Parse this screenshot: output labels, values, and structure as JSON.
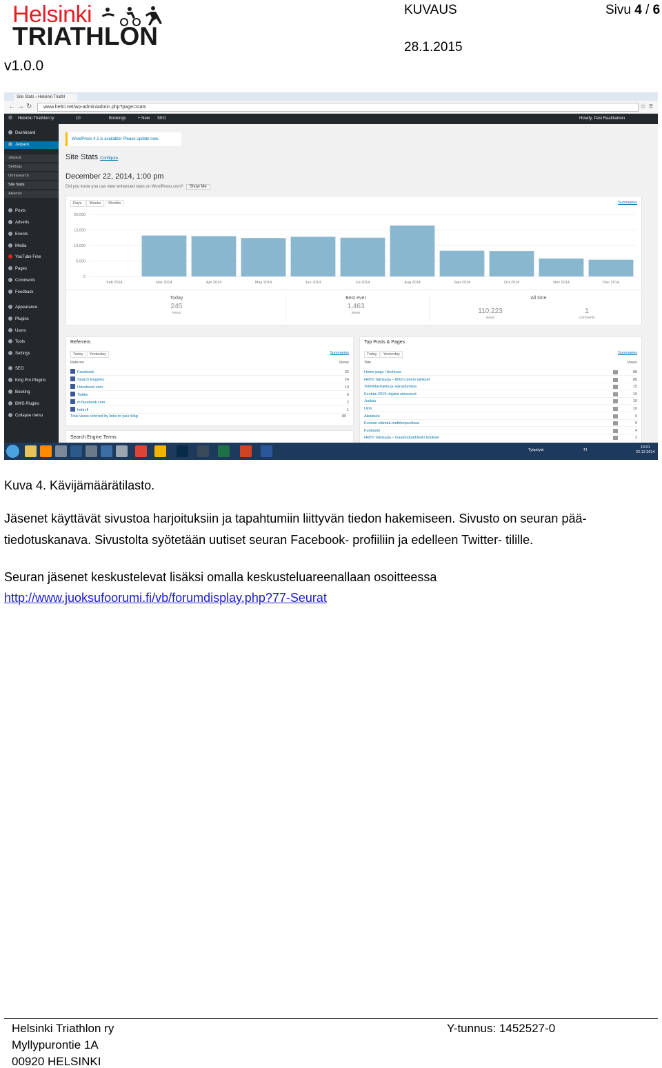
{
  "header": {
    "logo_top": "Helsinki",
    "logo_bottom": "TRIATHLON",
    "version": "v1.0.0",
    "doc_title": "KUVAUS",
    "doc_date": "28.1.2015",
    "page_prefix": "Sivu",
    "page_current": "4",
    "page_sep": "/",
    "page_total": "6"
  },
  "screenshot": {
    "browser_tab": "Site Stats ‹ Helsinki Triathl",
    "url": "www.heltri.net/wp-admin/admin.php?page=stats",
    "adminbar": {
      "site": "Helsinki Triathlon ry",
      "updates": "10",
      "bookings": "Bookings",
      "new": "+ New",
      "seo": "SEO",
      "howdy": "Howdy, Pasi Raatikainen"
    },
    "sidebar": [
      {
        "label": "Dashboard"
      },
      {
        "label": "Jetpack"
      },
      {
        "label": "Jetpack"
      },
      {
        "label": "Settings"
      },
      {
        "label": "Omnisearch"
      },
      {
        "label": "Site Stats"
      },
      {
        "label": "Akismet"
      },
      {
        "label": "Posts"
      },
      {
        "label": "Adverts"
      },
      {
        "label": "Events"
      },
      {
        "label": "Media"
      },
      {
        "label": "YouTube Free"
      },
      {
        "label": "Pages"
      },
      {
        "label": "Comments"
      },
      {
        "label": "Feedback"
      },
      {
        "label": "Appearance"
      },
      {
        "label": "Plugins"
      },
      {
        "label": "Users"
      },
      {
        "label": "Tools"
      },
      {
        "label": "Settings"
      },
      {
        "label": "SEO"
      },
      {
        "label": "King Pro Plugins"
      },
      {
        "label": "Booking"
      },
      {
        "label": "BWS Plugins"
      },
      {
        "label": "Collapse menu"
      }
    ],
    "notice": "WordPress 4.1 is available! Please update now.",
    "site_stats": "Site Stats",
    "configure": "Configure",
    "date_heading": "December 22, 2014, 1:00 pm",
    "did_you_know": "Did you know you can view enhanced stats on WordPress.com?",
    "show_me": "Show Me",
    "period_tabs": [
      "Days",
      "Weeks",
      "Months"
    ],
    "summaries": "Summaries",
    "stats": {
      "today_label": "Today",
      "today_value": "245",
      "today_unit": "views",
      "best_label": "Best ever",
      "best_value": "1,463",
      "best_unit": "views",
      "all_label": "All time",
      "all_views": "110,223",
      "all_views_unit": "views",
      "all_comments": "1",
      "all_comments_unit": "comments"
    },
    "referrers": {
      "title": "Referrers",
      "tabs": [
        "Today",
        "Yesterday"
      ],
      "summaries": "Summaries",
      "col_left": "Referrer",
      "col_right": "Views",
      "rows": [
        {
          "name": "Facebook",
          "views": "32"
        },
        {
          "name": "Search Engines",
          "views": "24"
        },
        {
          "name": "l.facebook.com",
          "views": "10"
        },
        {
          "name": "Twitter",
          "views": "6"
        },
        {
          "name": "m.facebook.com",
          "views": "2"
        },
        {
          "name": "heltri.fi",
          "views": "1"
        }
      ],
      "total_label": "Total views referred by links to your blog",
      "total_value": "80"
    },
    "search_terms": "Search Engine Terms",
    "top_posts": {
      "title": "Top Posts & Pages",
      "tabs": [
        "Today",
        "Yesterday"
      ],
      "summaries": "Summaries",
      "col_left": "Title",
      "col_right": "Views",
      "rows": [
        {
          "name": "Home page / Archives",
          "views": "88"
        },
        {
          "name": "HelTri Talvisarja – 800m uinnin tulokset",
          "views": "80"
        },
        {
          "name": "Toimintaohjeita ja sairastumisia",
          "views": "15"
        },
        {
          "name": "Kevään 2015 ohjatut uinivuorot",
          "views": "10"
        },
        {
          "name": "Juoksu",
          "views": "10"
        },
        {
          "name": "Uinti",
          "views": "10"
        },
        {
          "name": "Aikataulu",
          "views": "6"
        },
        {
          "name": "Kunnon elämää triathlonpuolissa",
          "views": "5"
        },
        {
          "name": "Kuntopiiri",
          "views": "4"
        },
        {
          "name": "HelTri Talvisarja – maastoduathlonin tulokset",
          "views": "3"
        },
        {
          "name": "Other posts",
          "views": "14"
        }
      ]
    },
    "taskbar": {
      "tray_label": "Työpöytä",
      "lang": "FI",
      "time": "13:01",
      "date": "22.12.2014"
    }
  },
  "chart_data": {
    "type": "bar",
    "categories": [
      "Feb 2014",
      "Mar 2014",
      "Apr 2014",
      "May 2014",
      "Jun 2014",
      "Jul 2014",
      "Aug 2014",
      "Sep 2014",
      "Oct 2014",
      "Nov 2014",
      "Dec 2014"
    ],
    "values": [
      0,
      13200,
      13000,
      12400,
      12800,
      12500,
      16400,
      8300,
      8200,
      5800,
      5400
    ],
    "yticks": [
      "0",
      "5,000",
      "10,000",
      "15,000",
      "20,000"
    ],
    "ylim": [
      0,
      20000
    ],
    "bar_color": "#8ab7d0",
    "title": "",
    "xlabel": "",
    "ylabel": ""
  },
  "body": {
    "caption": "Kuva 4. Kävijämäärätilasto.",
    "p1": "Jäsenet käyttävät sivustoa harjoituksiin ja tapahtumiin liittyvän tiedon hakemiseen. Sivusto on seuran pää-tiedotuskanava. Sivustolta syötetään uutiset seuran Facebook- profiiliin ja edelleen Twitter- tilille.",
    "p2": "Seuran jäsenet keskustelevat lisäksi omalla keskusteluareenallaan osoitteessa",
    "link": "http://www.juoksufoorumi.fi/vb/forumdisplay.php?77-Seurat"
  },
  "footer": {
    "org": "Helsinki Triathlon ry",
    "street": "Myllypurontie 1A",
    "city": "00920 HELSINKI",
    "business_id": "Y-tunnus: 1452527-0"
  },
  "colors": {
    "logo_red": "#e31e24",
    "wp_dark": "#23282d",
    "wp_blue": "#0073aa",
    "link_blue": "#1a1ad6"
  }
}
